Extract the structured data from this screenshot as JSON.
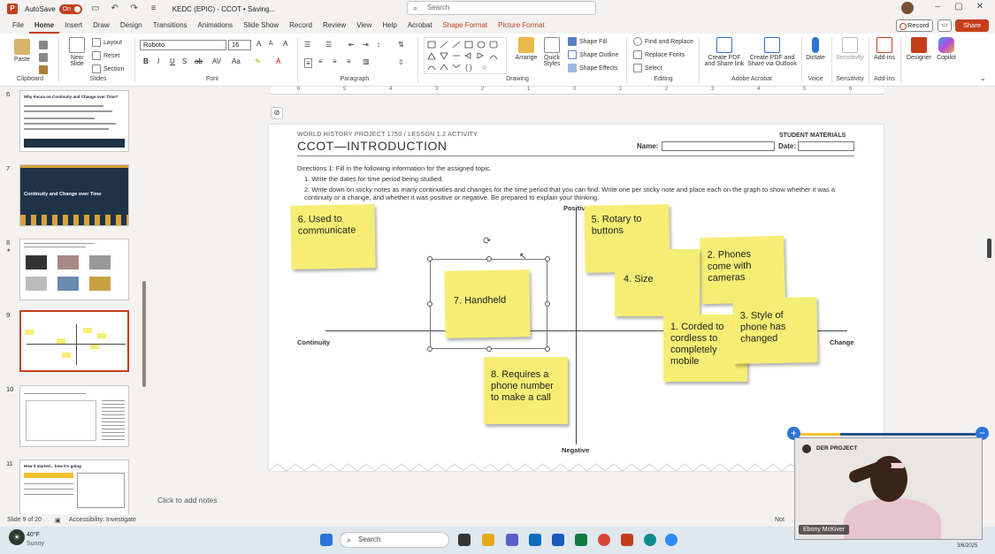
{
  "titlebar": {
    "autosave_label": "AutoSave",
    "autosave_state": "On",
    "doc_title": "KEDC (EPIC) - CCOT • Saving...",
    "search_placeholder": "Search"
  },
  "tabs": [
    "File",
    "Home",
    "Insert",
    "Draw",
    "Design",
    "Transitions",
    "Animations",
    "Slide Show",
    "Record",
    "Review",
    "View",
    "Help",
    "Acrobat",
    "Shape Format",
    "Picture Format"
  ],
  "active_tab": "Home",
  "top_buttons": {
    "record": "Record",
    "share": "Share"
  },
  "ribbon": {
    "clipboard": {
      "paste": "Paste",
      "label": "Clipboard"
    },
    "slides": {
      "new_slide": "New Slide",
      "layout": "Layout",
      "reset": "Reset",
      "section": "Section",
      "label": "Slides"
    },
    "font": {
      "name": "Roboto",
      "size": "16",
      "label": "Font"
    },
    "paragraph": {
      "label": "Paragraph"
    },
    "drawing": {
      "arrange": "Arrange",
      "quick_styles": "Quick Styles",
      "shape_fill": "Shape Fill",
      "shape_outline": "Shape Outline",
      "shape_effects": "Shape Effects",
      "label": "Drawing"
    },
    "editing": {
      "find_replace": "Find and Replace",
      "replace_fonts": "Replace Fonts",
      "select": "Select",
      "label": "Editing"
    },
    "adobe": {
      "create_pdf_share": "Create PDF and Share link",
      "create_pdf_outlook": "Create PDF and Share via Outlook",
      "label": "Adobe Acrobat"
    },
    "voice": {
      "dictate": "Dictate",
      "label": "Voice"
    },
    "sensitivity": {
      "sensitivity": "Sensitivity",
      "label": "Sensitivity"
    },
    "addins": {
      "addins": "Add-ins",
      "label": "Add-ins"
    },
    "designer": "Designer",
    "copilot": "Copilot"
  },
  "ruler_ticks": [
    "6",
    "5",
    "4",
    "3",
    "2",
    "1",
    "0",
    "1",
    "2",
    "3",
    "4",
    "5",
    "6"
  ],
  "slide_panel": {
    "slides": [
      {
        "num": "6",
        "title": "Why Focus on Continuity and Change over Time?"
      },
      {
        "num": "7",
        "title": "Continuity and Change over Time"
      },
      {
        "num": "8",
        "title": ""
      },
      {
        "num": "9",
        "title": ""
      },
      {
        "num": "10",
        "title": ""
      },
      {
        "num": "11",
        "title": "How it started... how it's going"
      }
    ]
  },
  "slide": {
    "header_small": "WORLD HISTORY PROJECT 1750 / LESSON 1.2 ACTIVITY",
    "header_big": "CCOT—INTRODUCTION",
    "student_materials": "STUDENT MATERIALS",
    "name_label": "Name:",
    "date_label": "Date:",
    "directions": "Directions 1: Fill in the following information for the assigned topic.",
    "dir_1": "1.   Write the dates for time period being studied.",
    "dir_2": "2.   Write down on sticky notes as many continuities and changes for the time period that you can find. Write one per sticky note and place each on the graph to show whether it was a continuity or a change, and whether it was positive or negative. Be prepared to explain your thinking.",
    "axis_positive": "Positive",
    "axis_negative": "Negative",
    "axis_continuity": "Continuity",
    "axis_change": "Change",
    "sticky_notes": [
      {
        "text": "6. Used to communicate"
      },
      {
        "text": "5. Rotary to buttons"
      },
      {
        "text": "2. Phones come with cameras"
      },
      {
        "text": "4. Size"
      },
      {
        "text": "7. Handheld"
      },
      {
        "text": "1. Corded to cordless to completely mobile"
      },
      {
        "text": "3. Style of phone has changed"
      },
      {
        "text": "8. Requires a phone number to make a call"
      }
    ]
  },
  "notes_placeholder": "Click to add notes",
  "statusbar": {
    "slide_count": "Slide 9 of 20",
    "accessibility": "Accessibility: Investigate",
    "notes": "Not"
  },
  "taskbar": {
    "search": "Search",
    "weather_temp": "40°F",
    "weather_cond": "Sunny",
    "date": "3/6/2025"
  },
  "video": {
    "project_label": "DER PROJECT",
    "person_name": "Ebony McKiver"
  },
  "colors": {
    "accent": "#c43e1c",
    "sticky": "#f6ee74",
    "taskbar": "#dfe7ef"
  }
}
